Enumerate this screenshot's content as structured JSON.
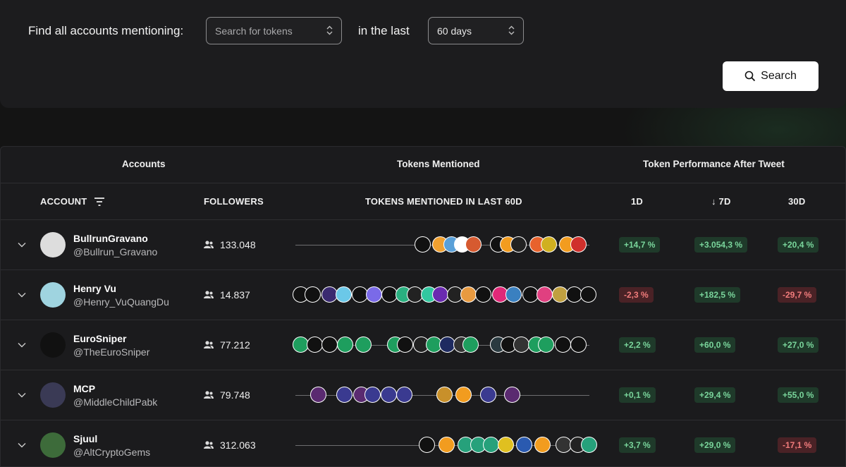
{
  "search": {
    "find_label": "Find all accounts mentioning:",
    "token_placeholder": "Search for tokens",
    "in_last_label": "in the last",
    "days_value": "60 days",
    "button_label": "Search"
  },
  "table": {
    "groups": {
      "accounts": "Accounts",
      "tokens": "Tokens Mentioned",
      "performance": "Token Performance After Tweet"
    },
    "columns": {
      "account": "ACCOUNT",
      "followers": "FOLLOWERS",
      "tokens": "TOKENS MENTIONED IN LAST 60D",
      "d1": "1D",
      "d7": "↓ 7D",
      "d30": "30D"
    },
    "rows": [
      {
        "name": "BullrunGravano",
        "handle": "@Bullrun_Gravano",
        "followers": "133.048",
        "d1": "+14,7 %",
        "d7": "+3.054,3 %",
        "d30": "+20,4 %"
      },
      {
        "name": "Henry Vu",
        "handle": "@Henry_VuQuangDu",
        "followers": "14.837",
        "d1": "-2,3 %",
        "d7": "+182,5 %",
        "d30": "-29,7 %"
      },
      {
        "name": "EuroSniper",
        "handle": "@TheEuroSniper",
        "followers": "77.212",
        "d1": "+2,2 %",
        "d7": "+60,0 %",
        "d30": "+27,0 %"
      },
      {
        "name": "MCP",
        "handle": "@MiddleChildPabk",
        "followers": "79.748",
        "d1": "+0,1 %",
        "d7": "+29,4 %",
        "d30": "+55,0 %"
      },
      {
        "name": "Sjuul",
        "handle": "@AltCryptoGems",
        "followers": "312.063",
        "d1": "+3,7 %",
        "d7": "+29,0 %",
        "d30": "-17,1 %"
      }
    ]
  },
  "colors": {
    "positive": "#7ad69c",
    "negative": "#f27c7c",
    "background": "#141414"
  }
}
